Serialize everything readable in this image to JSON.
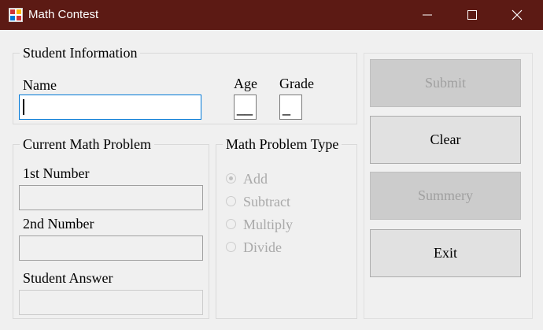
{
  "window": {
    "title": "Math Contest",
    "titlebar_color": "#5c1a14"
  },
  "student_info": {
    "legend": "Student Information",
    "name_label": "Name",
    "name_value": "",
    "age_label": "Age",
    "age_value": "__",
    "grade_label": "Grade",
    "grade_value": "_"
  },
  "problem": {
    "legend": "Current Math Problem",
    "first_label": "1st Number",
    "first_value": "",
    "second_label": "2nd Number",
    "second_value": "",
    "answer_label": "Student Answer",
    "answer_value": ""
  },
  "problem_type": {
    "legend": "Math Problem Type",
    "options": [
      {
        "label": "Add",
        "selected": true
      },
      {
        "label": "Subtract",
        "selected": false
      },
      {
        "label": "Multiply",
        "selected": false
      },
      {
        "label": "Divide",
        "selected": false
      }
    ]
  },
  "buttons": {
    "submit": "Submit",
    "clear": "Clear",
    "summery": "Summery",
    "exit": "Exit"
  },
  "icons": [
    "app-icon",
    "minimize-icon",
    "maximize-icon",
    "close-icon"
  ]
}
